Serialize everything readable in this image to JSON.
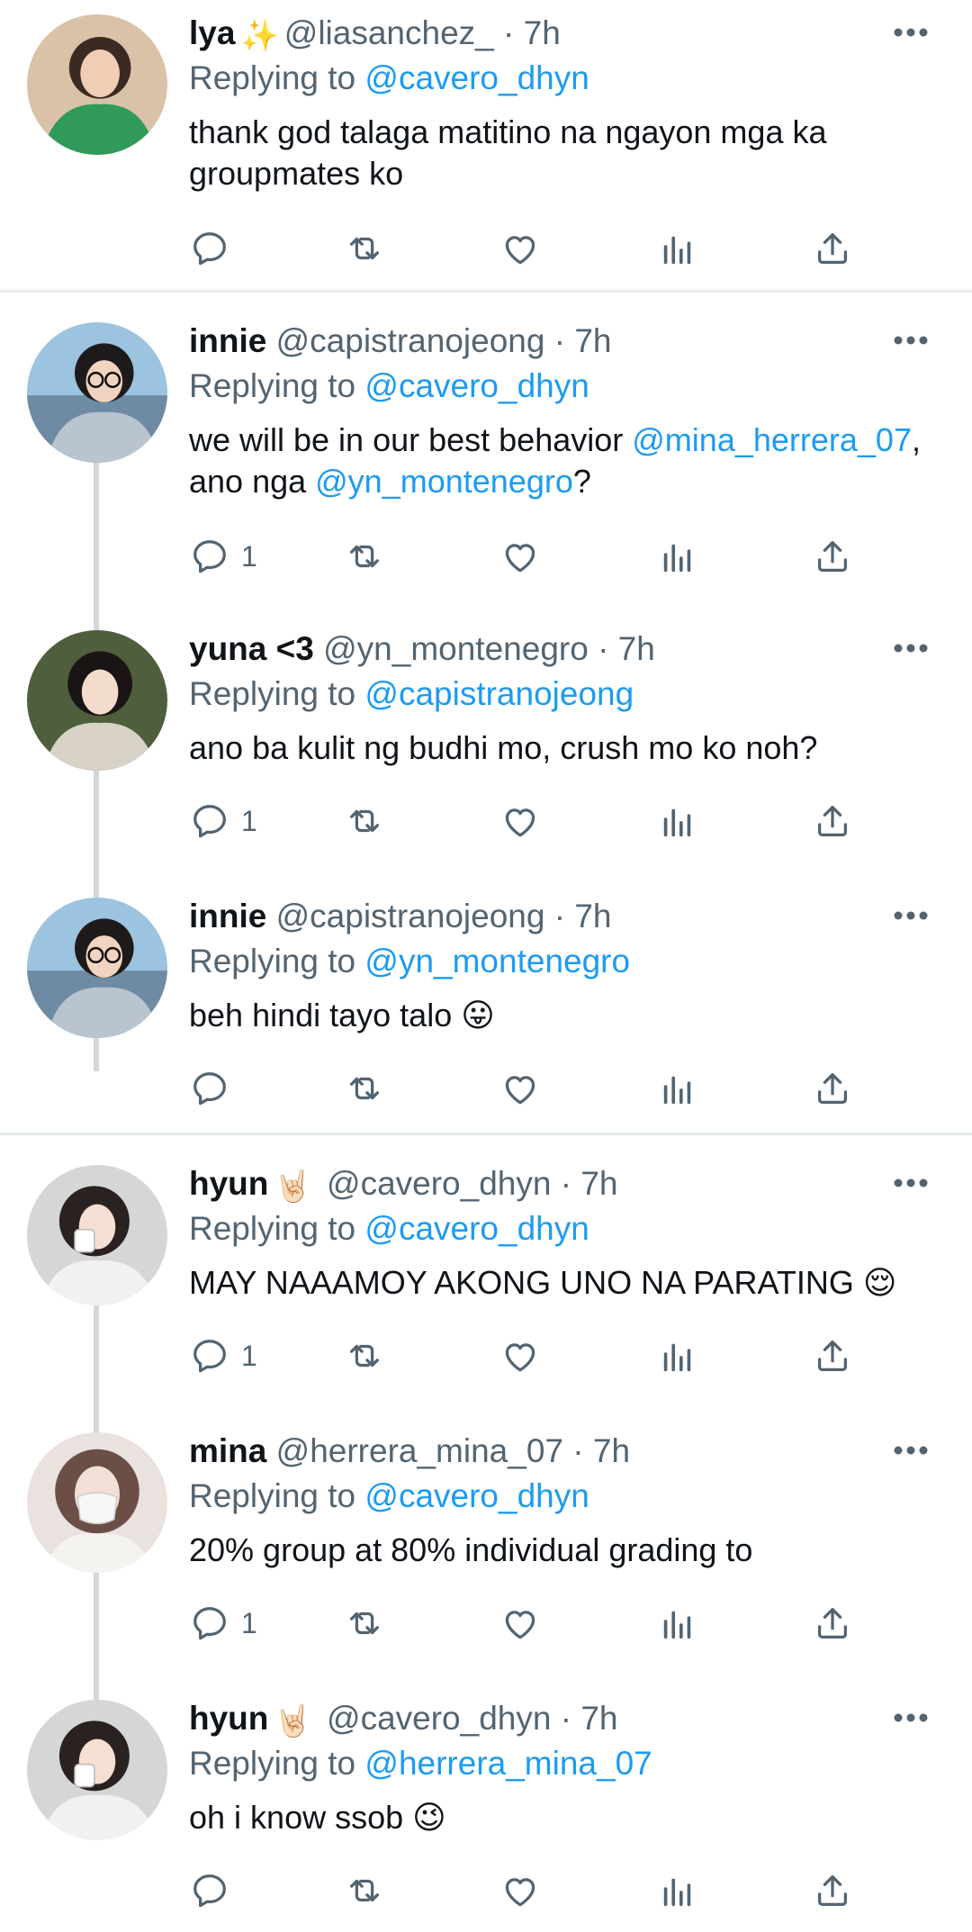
{
  "tweets": [
    {
      "name": "lya",
      "badge": "✨",
      "handle": "@liasanchez_",
      "time": "· 7h",
      "replying_prefix": "Replying to",
      "replying_to": "@cavero_dhyn",
      "text": "thank god talaga matitino na ngayon mga ka groupmates ko",
      "reply_count": "",
      "avatar_colors": [
        "#2f9a5a",
        "#6b4a3a"
      ]
    },
    {
      "name": "innie",
      "badge": "",
      "handle": "@capistranojeong",
      "time": "· 7h",
      "replying_prefix": "Replying to",
      "replying_to": "@cavero_dhyn",
      "text_parts": [
        {
          "t": "we will be in our best behavior ",
          "link": false
        },
        {
          "t": "@mina_herrera_07",
          "link": true
        },
        {
          "t": ", ano nga ",
          "link": false
        },
        {
          "t": "@yn_montenegro",
          "link": true
        },
        {
          "t": "?",
          "link": false
        }
      ],
      "reply_count": "1",
      "avatar_colors": [
        "#7fa8c8",
        "#b9c4cf"
      ]
    },
    {
      "name": "yuna <3",
      "badge": "",
      "handle": "@yn_montenegro",
      "time": "· 7h",
      "replying_prefix": "Replying to",
      "replying_to": "@capistranojeong",
      "text": "ano ba kulit ng budhi mo, crush mo ko noh?",
      "reply_count": "1",
      "avatar_colors": [
        "#5a6b4a",
        "#d8d2c8"
      ]
    },
    {
      "name": "innie",
      "badge": "",
      "handle": "@capistranojeong",
      "time": "· 7h",
      "replying_prefix": "Replying to",
      "replying_to": "@yn_montenegro",
      "text": "beh hindi tayo talo 😛",
      "reply_count": "",
      "avatar_colors": [
        "#7fa8c8",
        "#b9c4cf"
      ]
    },
    {
      "name": "hyun",
      "badge": "🤘🏻",
      "handle": "@cavero_dhyn",
      "time": "· 7h",
      "replying_prefix": "Replying to",
      "replying_to": "@cavero_dhyn",
      "text": "MAY NAAAMOY AKONG UNO NA PARATING 😌",
      "reply_count": "1",
      "avatar_colors": [
        "#e6e6e6",
        "#2a2220"
      ]
    },
    {
      "name": "mina",
      "badge": "",
      "handle": "@herrera_mina_07",
      "time": "· 7h",
      "replying_prefix": "Replying to",
      "replying_to": "@cavero_dhyn",
      "text": "20% group at 80% individual grading to",
      "reply_count": "1",
      "avatar_colors": [
        "#c9b7b0",
        "#f2f2f0"
      ]
    },
    {
      "name": "hyun",
      "badge": "🤘🏻",
      "handle": "@cavero_dhyn",
      "time": "· 7h",
      "replying_prefix": "Replying to",
      "replying_to": "@herrera_mina_07",
      "text": "oh i know ssob 😉",
      "reply_count": "",
      "avatar_colors": [
        "#e6e6e6",
        "#2a2220"
      ]
    }
  ],
  "colors": {
    "link": "#1d9bf0",
    "secondary": "#536471",
    "icon": "#536471",
    "divider": "#e6ecf0",
    "thread_line": "#cfd9de"
  },
  "icons": {
    "reply": "reply-icon",
    "retweet": "retweet-icon",
    "like": "heart-icon",
    "views": "views-icon",
    "share": "share-icon",
    "more": "more-icon"
  }
}
